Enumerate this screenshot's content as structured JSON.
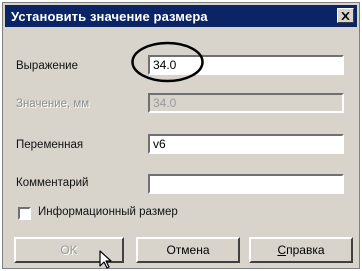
{
  "dialog": {
    "title": "Установить значение размера",
    "close_icon": "close-icon"
  },
  "fields": {
    "expression": {
      "label": "Выражение",
      "value": "34.0"
    },
    "value_mm": {
      "label": "Значение, мм",
      "value": "34.0"
    },
    "variable": {
      "label": "Переменная",
      "value": "v6"
    },
    "comment": {
      "label": "Комментарий",
      "value": ""
    }
  },
  "checkbox": {
    "label": "Информационный размер",
    "checked": false
  },
  "buttons": {
    "ok": "OK",
    "cancel": "Отмена",
    "help_first": "С",
    "help_rest": "правка"
  },
  "colors": {
    "titlebar": "#0a2466",
    "highlight_ellipse": "#000000"
  }
}
